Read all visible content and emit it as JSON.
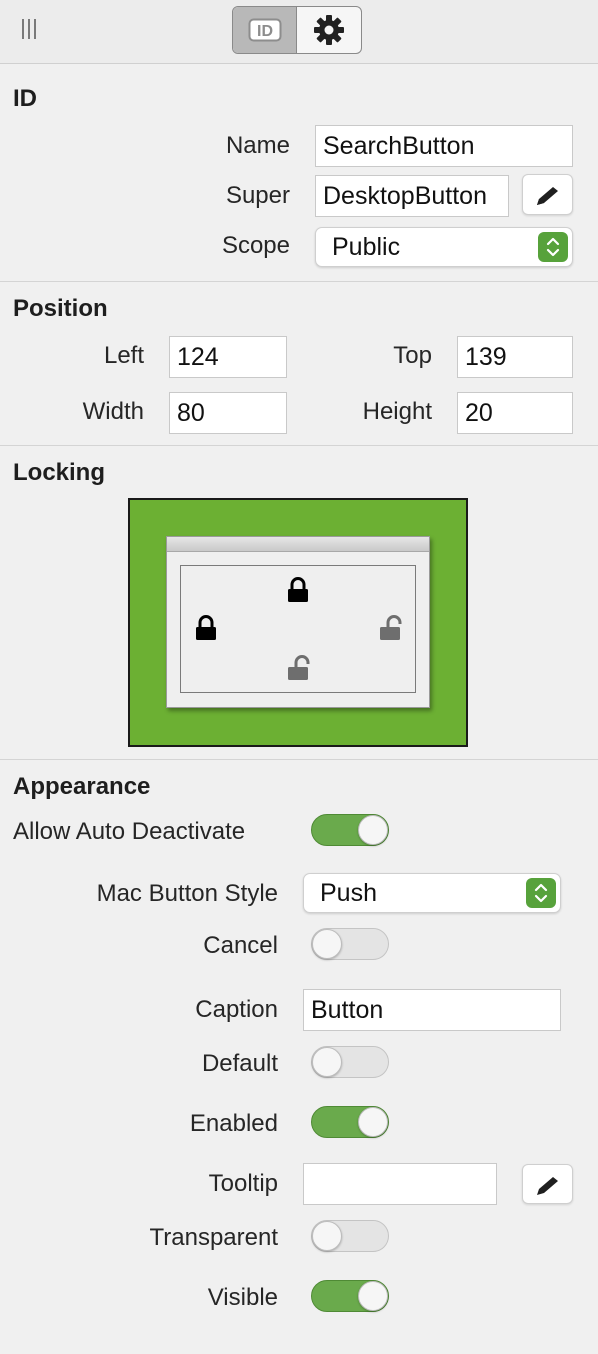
{
  "toolbar": {
    "tabs": [
      {
        "name": "id-tab",
        "icon": "id-icon",
        "selected": true
      },
      {
        "name": "settings-tab",
        "icon": "gear-icon",
        "selected": false
      }
    ]
  },
  "id_section": {
    "title": "ID",
    "name_label": "Name",
    "name_value": "SearchButton",
    "super_label": "Super",
    "super_value": "DesktopButton",
    "scope_label": "Scope",
    "scope_value": "Public"
  },
  "position": {
    "title": "Position",
    "left_label": "Left",
    "left_value": "124",
    "top_label": "Top",
    "top_value": "139",
    "width_label": "Width",
    "width_value": "80",
    "height_label": "Height",
    "height_value": "20"
  },
  "locking": {
    "title": "Locking",
    "top_locked": true,
    "left_locked": true,
    "right_locked": false,
    "bottom_locked": false
  },
  "appearance": {
    "title": "Appearance",
    "allow_auto_deactivate_label": "Allow Auto Deactivate",
    "allow_auto_deactivate": true,
    "mac_button_style_label": "Mac Button Style",
    "mac_button_style_value": "Push",
    "cancel_label": "Cancel",
    "cancel": false,
    "caption_label": "Caption",
    "caption_value": "Button",
    "default_label": "Default",
    "default": false,
    "enabled_label": "Enabled",
    "enabled": true,
    "tooltip_label": "Tooltip",
    "tooltip_value": "",
    "transparent_label": "Transparent",
    "transparent": false,
    "visible_label": "Visible",
    "visible": true
  },
  "colors": {
    "accent_green": "#6aaa4c",
    "locking_bg": "#6cb033",
    "popup_arrow": "#57a23b"
  }
}
